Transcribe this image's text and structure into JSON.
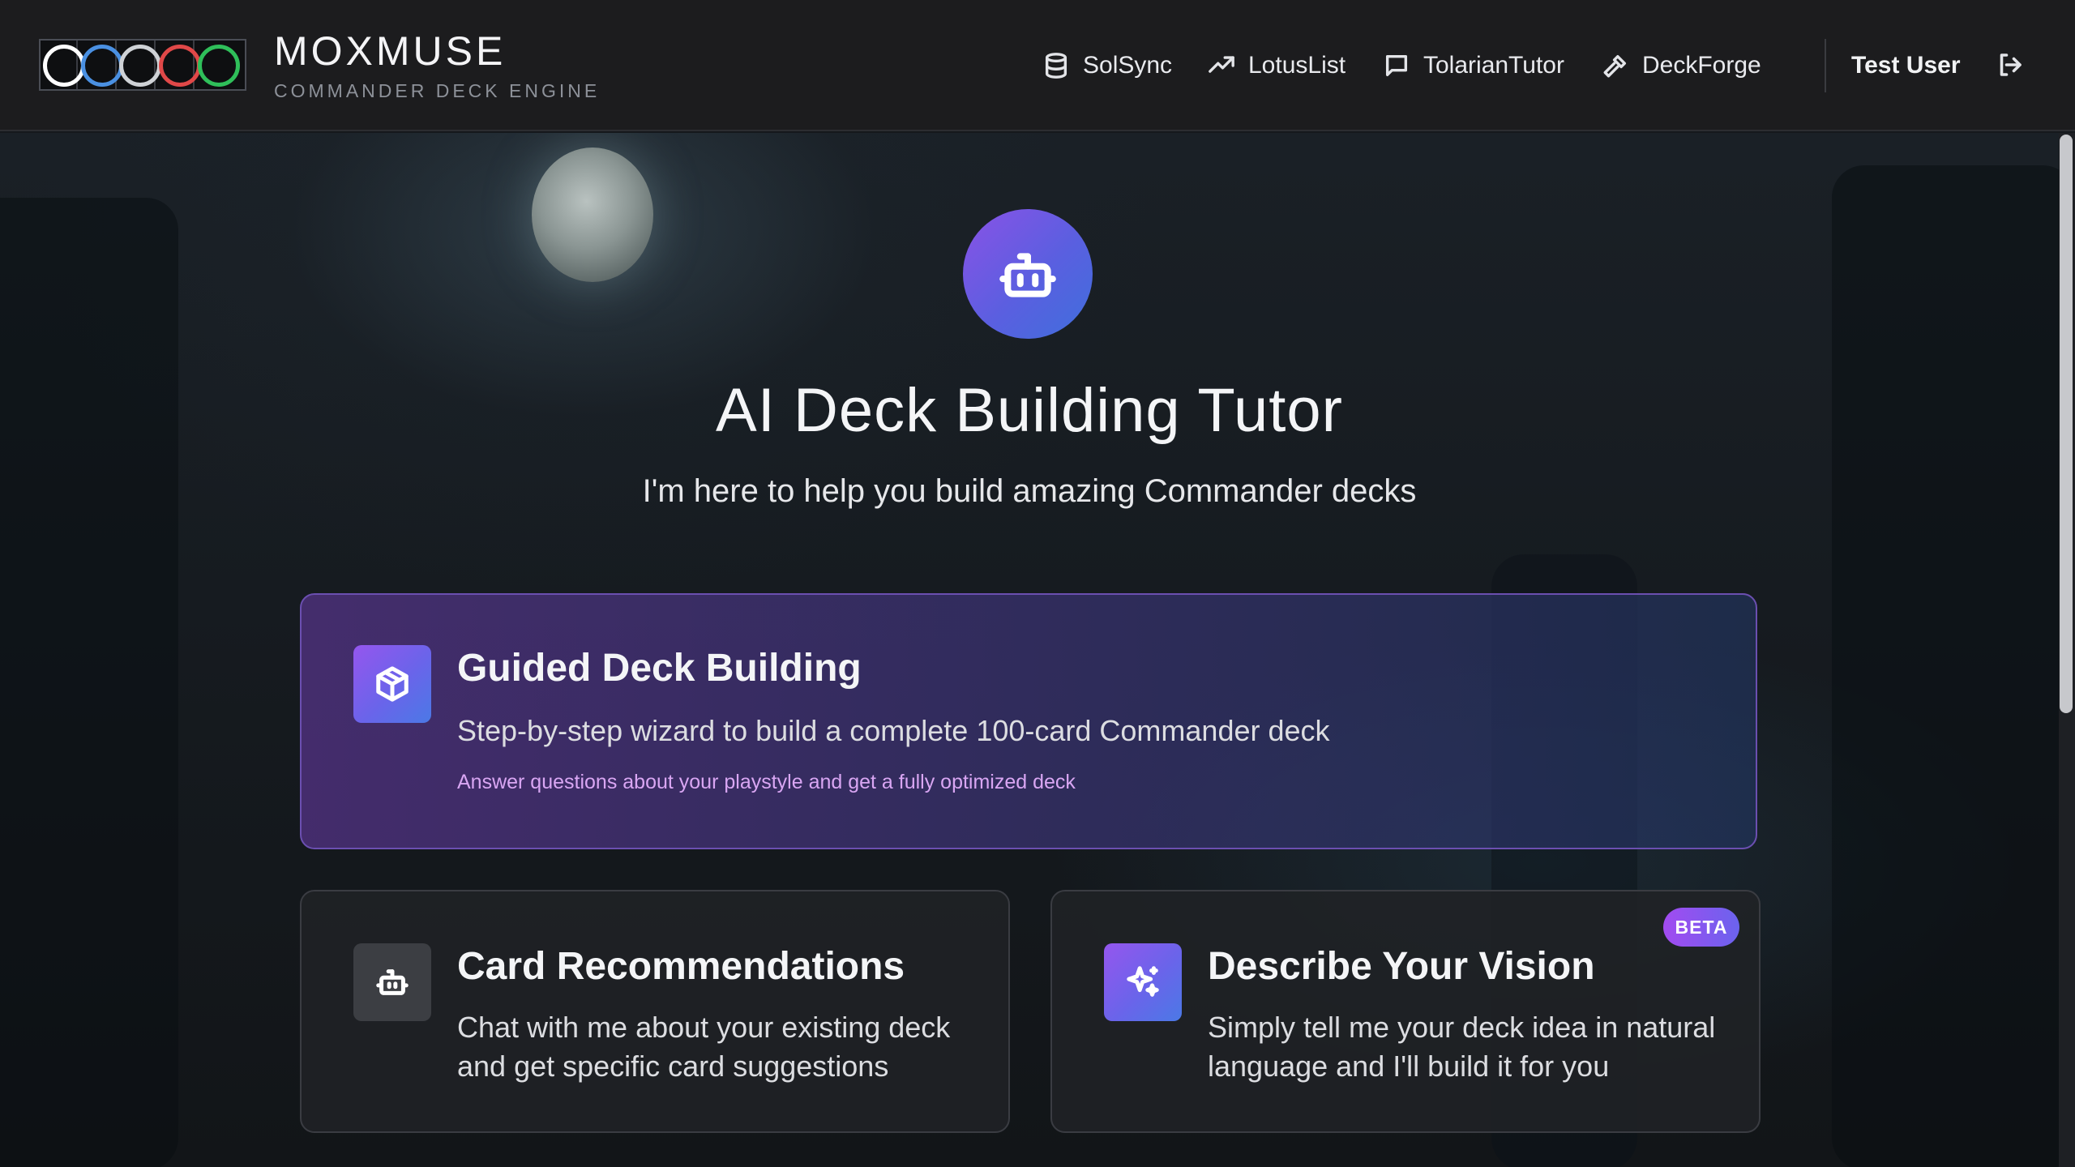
{
  "header": {
    "brand_title": "MOXMUSE",
    "brand_subtitle": "COMMANDER DECK ENGINE",
    "logo_icon": "mana-color-circles-icon",
    "nav": [
      {
        "label": "SolSync",
        "icon": "database-icon"
      },
      {
        "label": "LotusList",
        "icon": "trending-up-icon"
      },
      {
        "label": "TolarianTutor",
        "icon": "chat-bubble-icon"
      },
      {
        "label": "DeckForge",
        "icon": "hammer-icon"
      }
    ],
    "user_name": "Test User",
    "logout_icon": "logout-icon"
  },
  "hero": {
    "icon": "robot-icon",
    "title": "AI Deck Building Tutor",
    "subtitle": "I'm here to help you build amazing Commander decks"
  },
  "cards": {
    "guided": {
      "icon": "cube-icon",
      "title": "Guided Deck Building",
      "description": "Step-by-step wizard to build a complete 100-card Commander deck",
      "note": "Answer questions about your playstyle and get a fully optimized deck"
    },
    "recommendations": {
      "icon": "robot-icon",
      "title": "Card Recommendations",
      "description_line1": "Chat with me about your existing deck",
      "description_line2": "and get specific card suggestions"
    },
    "vision": {
      "icon": "sparkles-icon",
      "badge": "BETA",
      "title": "Describe Your Vision",
      "description_line1": "Simply tell me your deck idea in natural",
      "description_line2": "language and I'll build it for you"
    }
  },
  "colors": {
    "accent_purple": "#8a52e6",
    "accent_blue": "#3f6fdc",
    "note_pink": "#d9a6f3",
    "mana_white": "#ffffff",
    "mana_blue": "#4a90e2",
    "mana_black": "#cfd2d6",
    "mana_red": "#e04848",
    "mana_green": "#2fbf5a"
  }
}
